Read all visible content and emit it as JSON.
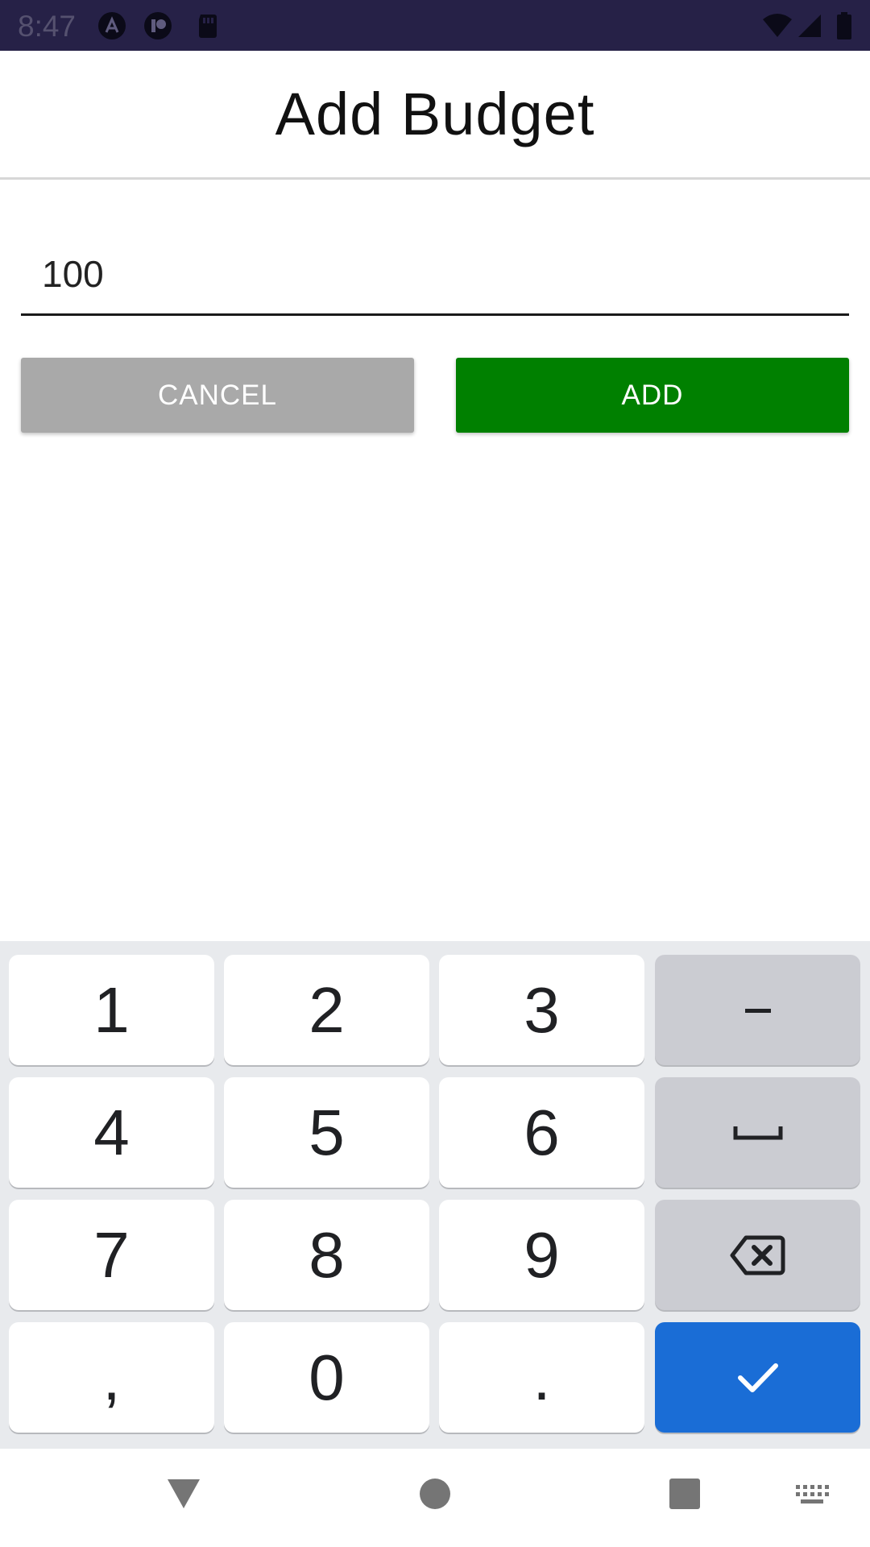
{
  "status_bar": {
    "time": "8:47",
    "icons_left": [
      "app-a-icon",
      "app-r-icon",
      "sd-card-icon"
    ],
    "icons_right": [
      "wifi-icon",
      "signal-icon",
      "battery-icon"
    ]
  },
  "header": {
    "title": "Add Budget"
  },
  "form": {
    "amount_value": "100",
    "cancel_label": "CANCEL",
    "add_label": "ADD"
  },
  "keyboard": {
    "rows": [
      [
        "1",
        "2",
        "3",
        "–"
      ],
      [
        "4",
        "5",
        "6",
        "space"
      ],
      [
        "7",
        "8",
        "9",
        "backspace"
      ],
      [
        ",",
        "0",
        ".",
        "enter"
      ]
    ]
  },
  "colors": {
    "status_bar": "#262147",
    "add_button": "#008000",
    "cancel_button": "#a9a9a9",
    "enter_key": "#1a6dd6"
  },
  "nav_bar": {
    "icons": [
      "back-icon",
      "home-icon",
      "recents-icon",
      "keyboard-switch-icon"
    ]
  }
}
